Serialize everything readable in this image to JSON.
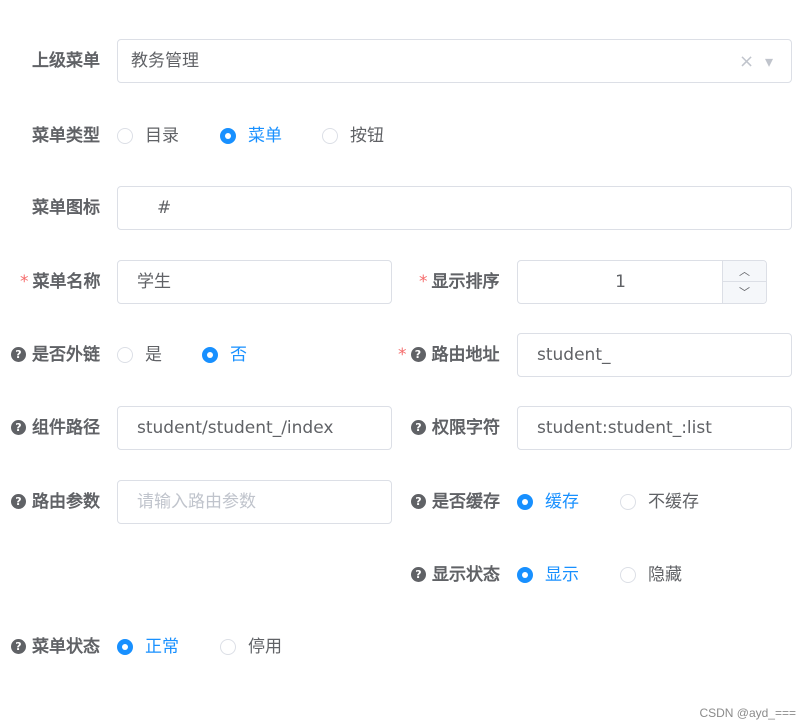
{
  "parent_menu": {
    "label": "上级菜单",
    "value": "教务管理",
    "clear_icon": "×",
    "arrow_icon": "▾"
  },
  "menu_type": {
    "label": "菜单类型",
    "options": [
      "目录",
      "菜单",
      "按钮"
    ],
    "selected": "菜单"
  },
  "menu_icon": {
    "label": "菜单图标",
    "value": "#"
  },
  "menu_name": {
    "label": "菜单名称",
    "required_mark": "*",
    "value": "学生"
  },
  "display_order": {
    "label": "显示排序",
    "required_mark": "*",
    "value": "1",
    "up_icon": "︿",
    "down_icon": "﹀"
  },
  "external_link": {
    "label": "是否外链",
    "help_icon": "?",
    "options": [
      "是",
      "否"
    ],
    "selected": "否"
  },
  "route_path": {
    "label": "路由地址",
    "required_mark": "*",
    "help_icon": "?",
    "value": "student_"
  },
  "component_path": {
    "label": "组件路径",
    "help_icon": "?",
    "value": "student/student_/index"
  },
  "permission": {
    "label": "权限字符",
    "help_icon": "?",
    "value": "student:student_:list"
  },
  "route_params": {
    "label": "路由参数",
    "help_icon": "?",
    "placeholder": "请输入路由参数"
  },
  "cache": {
    "label": "是否缓存",
    "help_icon": "?",
    "options": [
      "缓存",
      "不缓存"
    ],
    "selected": "缓存"
  },
  "visible": {
    "label": "显示状态",
    "help_icon": "?",
    "options": [
      "显示",
      "隐藏"
    ],
    "selected": "显示"
  },
  "status": {
    "label": "菜单状态",
    "help_icon": "?",
    "options": [
      "正常",
      "停用"
    ],
    "selected": "正常"
  },
  "watermark": "CSDN @ayd_===",
  "colors": {
    "accent": "#1890ff",
    "required": "#f56c6c",
    "border": "#dcdfe6",
    "placeholder": "#c0c4cc",
    "text": "#606266"
  }
}
